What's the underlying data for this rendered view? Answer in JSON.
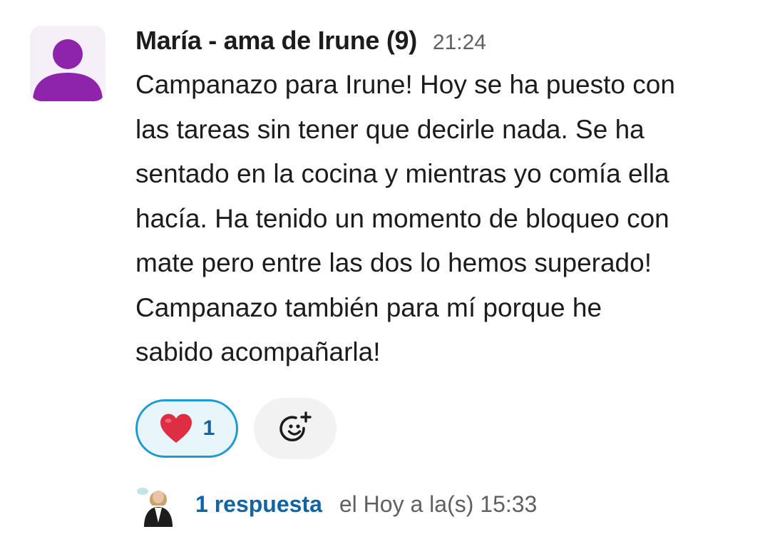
{
  "message": {
    "author": "María - ama de Irune (9)",
    "time": "21:24",
    "lines": [
      "Campanazo para Irune! Hoy se ha puesto con",
      "las tareas sin tener que decirle nada. Se ha",
      "sentado en la cocina y mientras yo comía ella",
      "hacía. Ha tenido un momento de bloqueo con",
      "mate pero entre las dos lo hemos superado!",
      "Campanazo también para mí porque he",
      "sabido acompañarla!"
    ]
  },
  "reactions": [
    {
      "emoji": "❤️",
      "icon": "heart-emoji",
      "count": "1",
      "active": true
    }
  ],
  "add_reaction": {
    "icon": "add-reaction-smiley-icon"
  },
  "thread": {
    "reply_count": "1 respuesta",
    "last_reply": "el Hoy a la(s) 15:33"
  },
  "colors": {
    "avatar_bg": "#f5f0f8",
    "avatar_figure": "#8e24aa",
    "reaction_border": "#1d9bd1",
    "reaction_bg": "#e8f5fa",
    "link_blue": "#1264a3",
    "muted_text": "#616061",
    "body_text": "#1d1c1d"
  }
}
